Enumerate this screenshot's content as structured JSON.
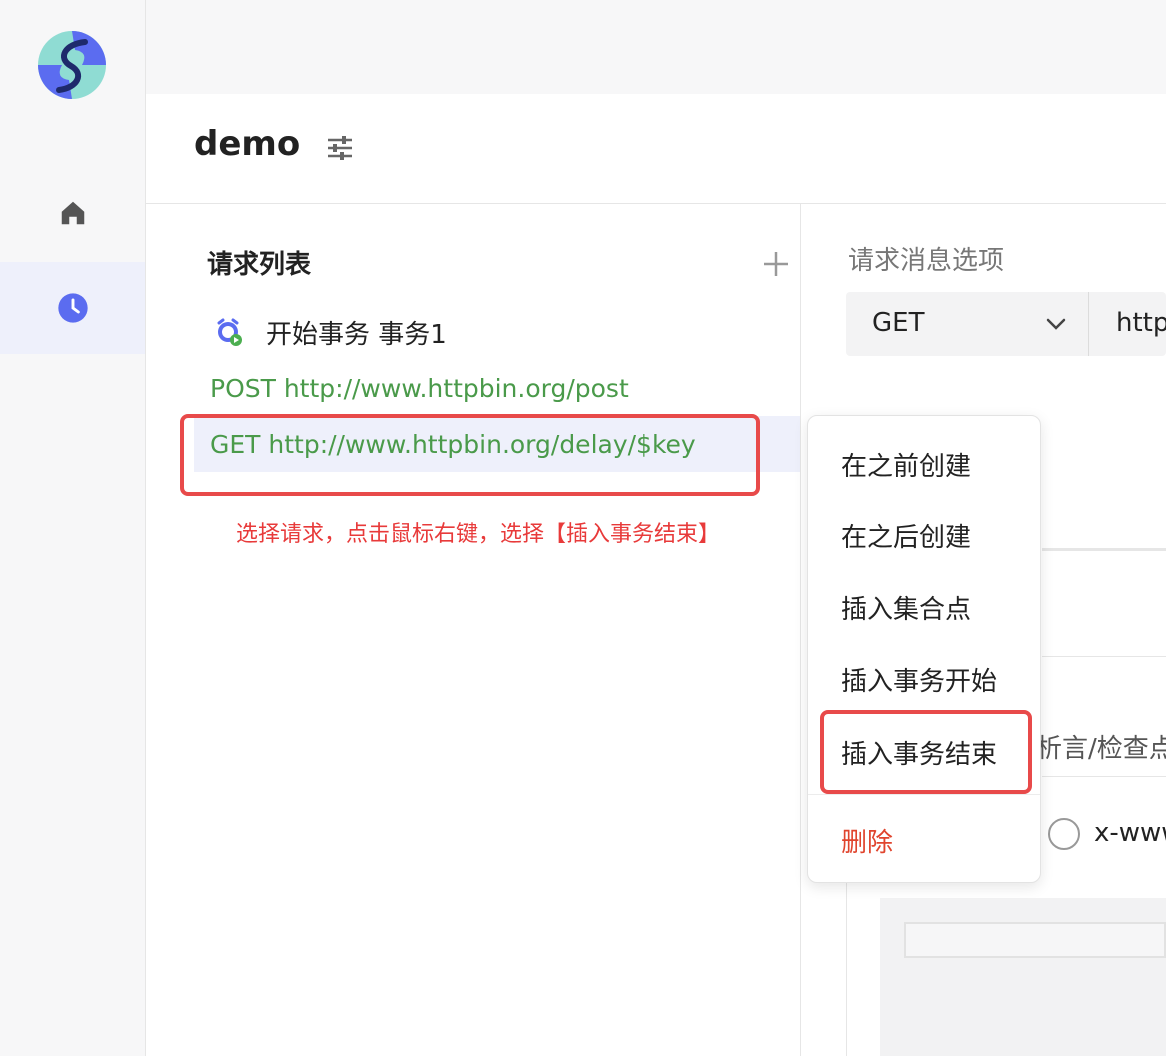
{
  "project": {
    "title": "demo"
  },
  "request_list": {
    "title": "请求列表",
    "transaction_start": "开始事务 事务1",
    "requests": [
      {
        "text": "POST http://www.httpbin.org/post"
      },
      {
        "text": "GET http://www.httpbin.org/delay/$key"
      }
    ]
  },
  "annotation": {
    "hint": "选择请求，点击鼠标右键，选择【插入事务结束】"
  },
  "request_options": {
    "label": "请求消息选项",
    "method": "GET",
    "url_partial": "http",
    "assert_partial": "析言/检查点",
    "radio_partial": "x-www"
  },
  "context_menu": {
    "items": [
      "在之前创建",
      "在之后创建",
      "插入集合点",
      "插入事务开始",
      "插入事务结束"
    ],
    "delete": "删除"
  },
  "colors": {
    "accent": "#5b6cf0",
    "request_green": "#4a9a4a",
    "highlight_red": "#e84a4a",
    "delete_red": "#e0442d"
  },
  "icons": [
    "app-logo-icon",
    "home-icon",
    "clock-icon",
    "settings-sliders-icon",
    "plus-icon",
    "alarm-clock-play-icon",
    "chevron-down-icon"
  ]
}
